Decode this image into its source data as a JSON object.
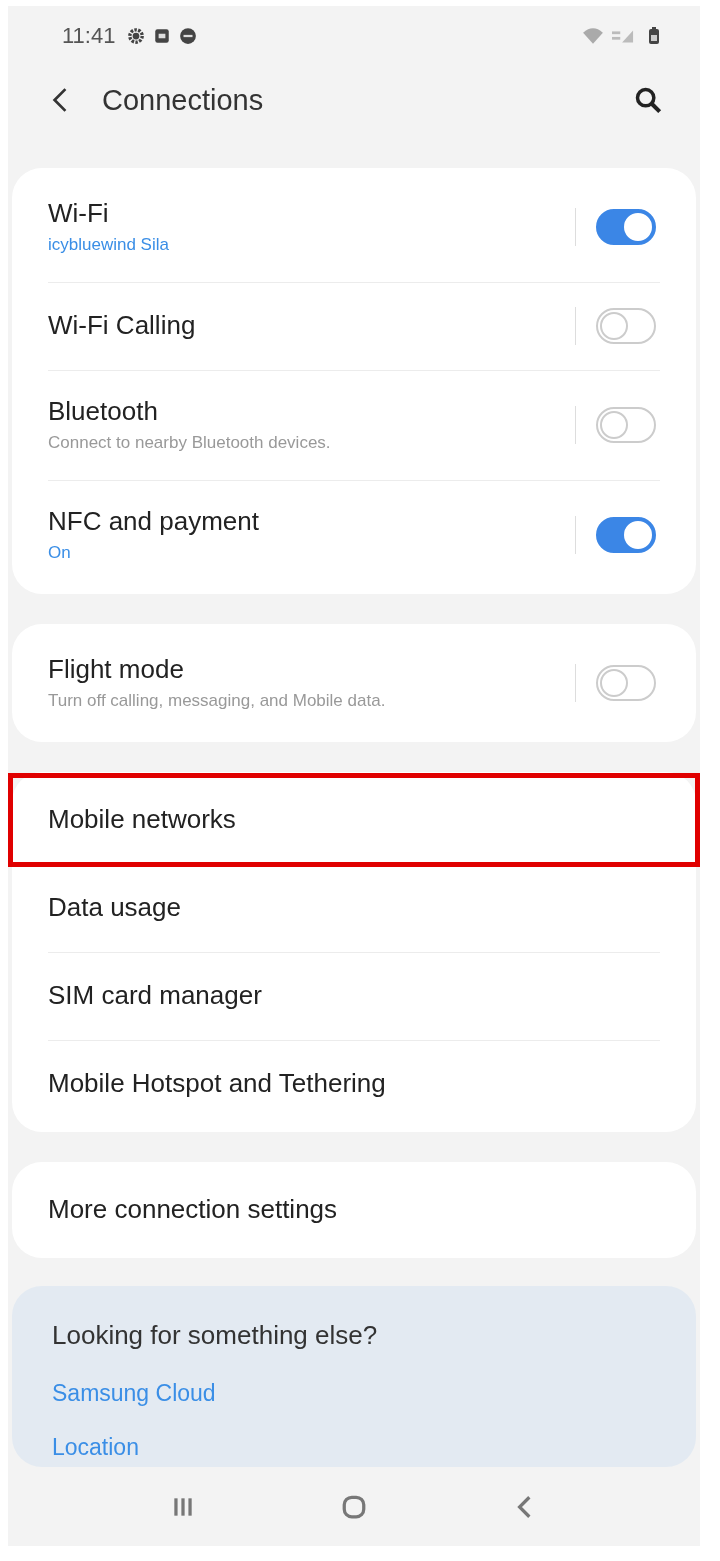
{
  "status_bar": {
    "time": "11:41"
  },
  "header": {
    "title": "Connections"
  },
  "sections": [
    {
      "items": [
        {
          "title": "Wi-Fi",
          "subtitle": "icybluewind Sila",
          "subtitle_accent": true,
          "toggle": true,
          "on": true,
          "highlighted": false
        },
        {
          "title": "Wi-Fi Calling",
          "toggle": true,
          "on": false,
          "highlighted": false
        },
        {
          "title": "Bluetooth",
          "subtitle": "Connect to nearby Bluetooth devices.",
          "subtitle_accent": false,
          "toggle": true,
          "on": false,
          "highlighted": false
        },
        {
          "title": "NFC and payment",
          "subtitle": "On",
          "subtitle_accent": true,
          "toggle": true,
          "on": true,
          "highlighted": false
        }
      ]
    },
    {
      "items": [
        {
          "title": "Flight mode",
          "subtitle": "Turn off calling, messaging, and Mobile data.",
          "subtitle_accent": false,
          "toggle": true,
          "on": false,
          "highlighted": false
        }
      ]
    },
    {
      "items": [
        {
          "title": "Mobile networks",
          "toggle": false,
          "highlighted": true
        },
        {
          "title": "Data usage",
          "toggle": false,
          "highlighted": false
        },
        {
          "title": "SIM card manager",
          "toggle": false,
          "highlighted": false
        },
        {
          "title": "Mobile Hotspot and Tethering",
          "toggle": false,
          "highlighted": false
        }
      ]
    },
    {
      "items": [
        {
          "title": "More connection settings",
          "toggle": false,
          "highlighted": false
        }
      ]
    }
  ],
  "suggestions": {
    "title": "Looking for something else?",
    "links": [
      "Samsung Cloud",
      "Location"
    ]
  }
}
